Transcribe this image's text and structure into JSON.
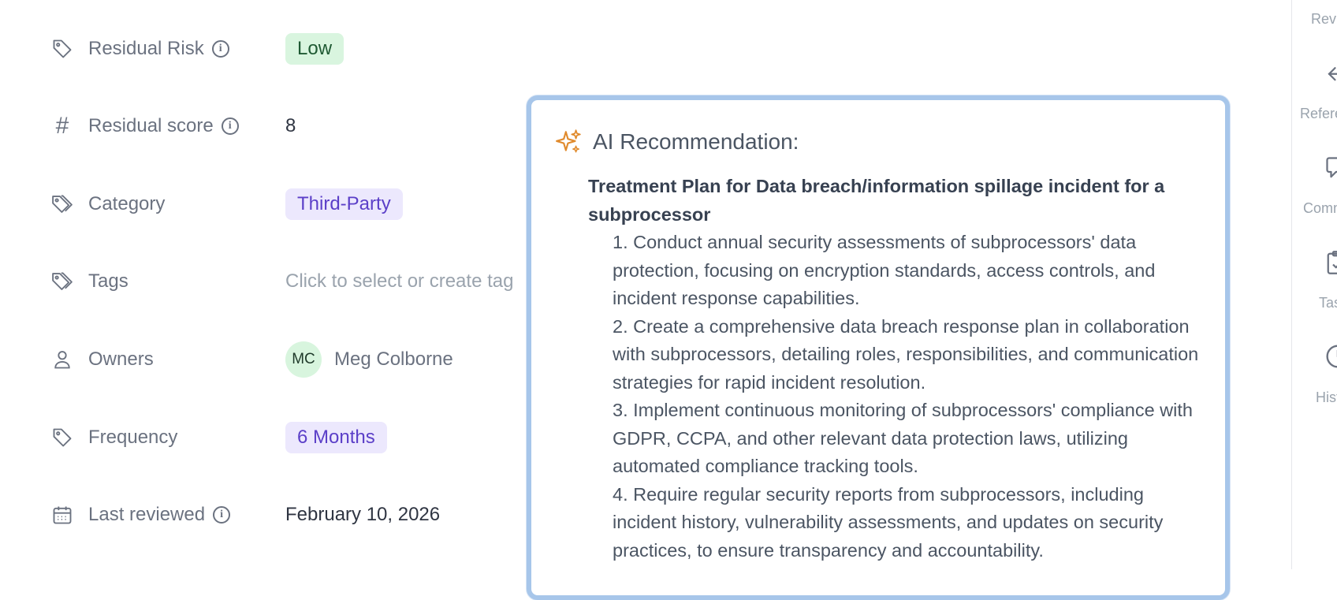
{
  "properties": {
    "residual_risk": {
      "label": "Residual Risk",
      "value": "Low"
    },
    "residual_score": {
      "label": "Residual score",
      "value": "8"
    },
    "category": {
      "label": "Category",
      "value": "Third-Party"
    },
    "tags": {
      "label": "Tags",
      "placeholder": "Click to select or create tag"
    },
    "owners": {
      "label": "Owners",
      "initials": "MC",
      "name": "Meg Colborne"
    },
    "frequency": {
      "label": "Frequency",
      "value": "6 Months"
    },
    "last_reviewed": {
      "label": "Last reviewed",
      "value": "February 10, 2026"
    }
  },
  "ai_card": {
    "title": "AI Recommendation:",
    "plan_title": "Treatment Plan for Data breach/information spillage incident for a subprocessor",
    "items": [
      "1. Conduct annual security assessments of subprocessors' data protection, focusing on encryption standards, access controls, and incident response capabilities.",
      "2. Create a comprehensive data breach response plan in collaboration with subprocessors, detailing roles, responsibilities, and communication strategies for rapid incident resolution.",
      "3. Implement continuous monitoring of subprocessors' compliance with GDPR, CCPA, and other relevant data protection laws, utilizing automated compliance tracking tools.",
      "4. Require regular security reports from subprocessors, including incident history, vulnerability assessments, and updates on security practices, to ensure transparency and accountability."
    ]
  },
  "sidebar": {
    "items": [
      {
        "label": "Revi",
        "icon": "review-icon"
      },
      {
        "label": "Refere",
        "icon": "arrow-left-icon"
      },
      {
        "label": "Comm",
        "icon": "comment-icon"
      },
      {
        "label": "Tas",
        "icon": "task-clipboard-icon"
      },
      {
        "label": "Hist",
        "icon": "history-icon"
      }
    ]
  },
  "colors": {
    "accent_border": "#a7c6ea",
    "sparkle": "#e08a2c",
    "low_pill_bg": "#d9f5df",
    "purple_pill_bg": "#ece8fd",
    "purple_pill_text": "#5b3fc8"
  }
}
